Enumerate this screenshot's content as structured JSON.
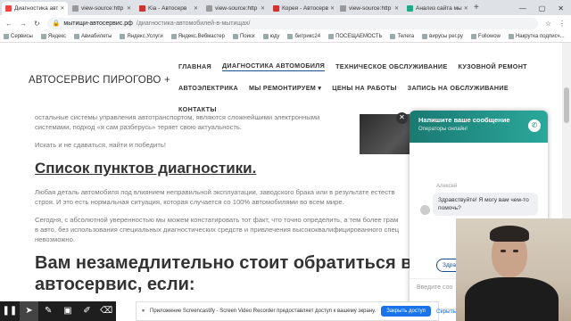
{
  "browser": {
    "tabs": [
      {
        "label": "Диагностика авт",
        "color": "#e44",
        "active": true
      },
      {
        "label": "view-source:http",
        "color": "#999",
        "active": false
      },
      {
        "label": "Kia - Автосерв",
        "color": "#c33",
        "active": false
      },
      {
        "label": "view-source:http",
        "color": "#999",
        "active": false
      },
      {
        "label": "Корея - Автосерв",
        "color": "#c33",
        "active": false
      },
      {
        "label": "view-source:http",
        "color": "#999",
        "active": false
      },
      {
        "label": "Анализ сайта мы",
        "color": "#2a8",
        "active": false
      }
    ],
    "new_tab": "+",
    "window_controls": [
      "—",
      "▢",
      "✕"
    ],
    "address": {
      "domain": "мытищи-автосервис.рф",
      "path": "/диагностика-автомобилей-в-мытищах/"
    },
    "bookmarks": [
      "Сервисы",
      "Яндекс",
      "Авиабилеты",
      "Яндекс.Услуги",
      "Яндекс.Вебмастер",
      "Поиск",
      "юду",
      "битрикс24",
      "ПОСЕЩАЕМОСТЬ",
      "Телега",
      "вирусы рег.ру",
      "Followow",
      "Накрутка подписч..."
    ]
  },
  "site": {
    "logo": "АВТОСЕРВИС ПИРОГОВО +",
    "nav_row1": [
      "ГЛАВНАЯ",
      "ДИАГНОСТИКА АВТОМОБИЛЯ",
      "ТЕХНИЧЕСКОЕ ОБСЛУЖИВАНИЕ",
      "КУЗОВНОЙ РЕМОНТ"
    ],
    "nav_row2": [
      "АВТОЭЛЕКТРИКА",
      "МЫ РЕМОНТИРУЕМ ▾",
      "ЦЕНЫ НА РАБОТЫ",
      "ЗАПИСЬ НА ОБСЛУЖИВАНИЕ"
    ],
    "nav_row3": [
      "КОНТАКТЫ"
    ],
    "text_top1": "остальные системы управления автотранспортом, являются сложнейшими электронными",
    "text_top2": "системами, подход «я сам разберусь» теряет свою актуальность.",
    "text_top3": "Искать и не сдаваться, найти и победить!",
    "heading1": "Список пунктов диагностики.",
    "para1_l1": "Любая деталь автомобиля под влиянием неправильной эксплуатации, заводского брака или в результате естеств",
    "para1_l2": "строя. И это есть нормальная ситуация, которая случается со 100% автомобилями во всем мире.",
    "para2_l1": "Сегодня, с абсолютной уверенностью мы можем констатировать тот факт, что точно определить, а тем более грам",
    "para2_l2": "в авто, без использования специальных диагностических средств и привлечения высококвалифицированного спец",
    "para2_l3": "невозможно.",
    "heading2_l1": "Вам незамедлительно стоит обратиться в на",
    "heading2_l2": "автосервис, если:"
  },
  "chat": {
    "close": "✕",
    "title": "Напишите ваше сообщение",
    "subtitle": "Операторы онлайн!",
    "agent": "Алексей",
    "message": "Здравствуйте! Я могу вам чем-то помочь?",
    "quick_reply": "Здра",
    "input_placeholder": "Введите соо"
  },
  "recorder": {
    "notice": "Приложение Screencastify - Screen Video Recorder предоставляет доступ к вашему экрану.",
    "stop_button": "Закрыть доступ",
    "hide": "Скрыть"
  }
}
